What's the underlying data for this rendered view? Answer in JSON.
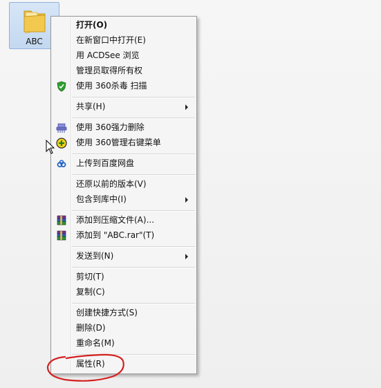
{
  "desktop": {
    "folder": {
      "label": "ABC"
    }
  },
  "context_menu": {
    "items": [
      {
        "label": "打开(O)",
        "bold": true,
        "icon": ""
      },
      {
        "label": "在新窗口中打开(E)",
        "icon": ""
      },
      {
        "label": "用 ACDSee 浏览",
        "icon": ""
      },
      {
        "label": "管理员取得所有权",
        "icon": ""
      },
      {
        "label": "使用 360杀毒 扫描",
        "icon": "shield-360-icon"
      },
      {
        "label": "共享(H)",
        "icon": "",
        "submenu": true
      },
      {
        "label": "使用 360强力删除",
        "icon": "shredder-360-icon"
      },
      {
        "label": "使用 360管理右键菜单",
        "icon": "plus-360-icon"
      },
      {
        "label": "上传到百度网盘",
        "icon": "baidu-cloud-icon"
      },
      {
        "label": "还原以前的版本(V)",
        "icon": ""
      },
      {
        "label": "包含到库中(I)",
        "icon": "",
        "submenu": true
      },
      {
        "label": "添加到压缩文件(A)...",
        "icon": "winrar-icon"
      },
      {
        "label": "添加到 \"ABC.rar\"(T)",
        "icon": "winrar-icon"
      },
      {
        "label": "发送到(N)",
        "icon": "",
        "submenu": true
      },
      {
        "label": "剪切(T)",
        "icon": ""
      },
      {
        "label": "复制(C)",
        "icon": ""
      },
      {
        "label": "创建快捷方式(S)",
        "icon": ""
      },
      {
        "label": "删除(D)",
        "icon": ""
      },
      {
        "label": "重命名(M)",
        "icon": ""
      },
      {
        "label": "属性(R)",
        "icon": ""
      }
    ]
  },
  "colors": {
    "menu_background": "#f5f5f5",
    "menu_border": "#979797",
    "selection_tile": "#cddff4",
    "annotation": "#d42020"
  }
}
